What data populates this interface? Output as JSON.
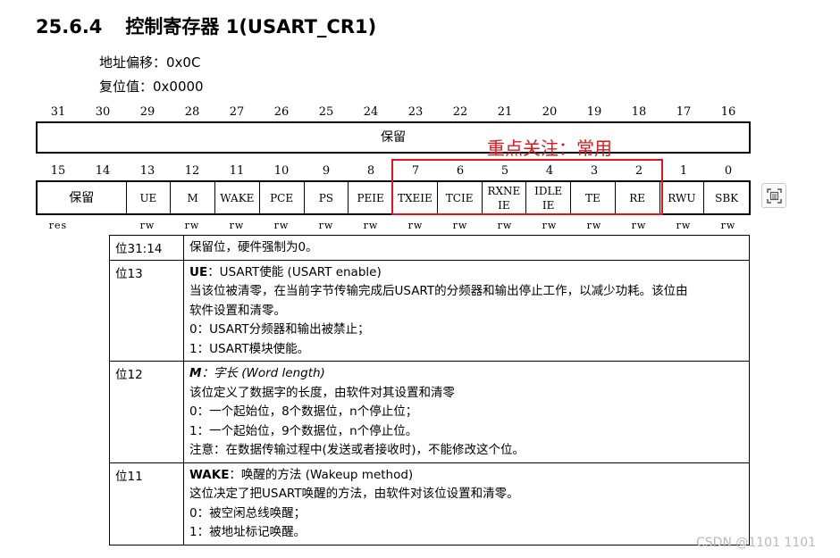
{
  "section": {
    "number": "25.6.4",
    "title": "控制寄存器 1(USART_CR1)"
  },
  "meta": {
    "offset": "地址偏移：0x0C",
    "reset": "复位值：0x0000"
  },
  "register": {
    "high_bit_numbers": [
      "31",
      "30",
      "29",
      "28",
      "27",
      "26",
      "25",
      "24",
      "23",
      "22",
      "21",
      "20",
      "19",
      "18",
      "17",
      "16"
    ],
    "high_reserved_label": "保留",
    "low_bit_numbers": [
      "15",
      "14",
      "13",
      "12",
      "11",
      "10",
      "9",
      "8",
      "7",
      "6",
      "5",
      "4",
      "3",
      "2",
      "1",
      "0"
    ],
    "low_fields": [
      {
        "label": "保留",
        "span": 2
      },
      {
        "label": "UE",
        "span": 1
      },
      {
        "label": "M",
        "span": 1
      },
      {
        "label": "WAKE",
        "span": 1
      },
      {
        "label": "PCE",
        "span": 1
      },
      {
        "label": "PS",
        "span": 1
      },
      {
        "label": "PEIE",
        "span": 1
      },
      {
        "label": "TXEIE",
        "span": 1
      },
      {
        "label": "TCIE",
        "span": 1
      },
      {
        "label": "RXNE\nIE",
        "span": 1
      },
      {
        "label": "IDLE\nIE",
        "span": 1
      },
      {
        "label": "TE",
        "span": 1
      },
      {
        "label": "RE",
        "span": 1
      },
      {
        "label": "RWU",
        "span": 1
      },
      {
        "label": "SBK",
        "span": 1
      }
    ],
    "access": [
      "res",
      "",
      "rw",
      "rw",
      "rw",
      "rw",
      "rw",
      "rw",
      "rw",
      "rw",
      "rw",
      "rw",
      "rw",
      "rw",
      "rw",
      "rw"
    ]
  },
  "annotation": {
    "text": "重点关注：常用",
    "color": "#e0141e"
  },
  "descriptions": [
    {
      "bit": "位31:14",
      "lines": [
        {
          "text": "保留位，硬件强制为0。"
        }
      ]
    },
    {
      "bit": "位13",
      "lines": [
        {
          "name": "UE",
          "rest": "：USART使能 (USART enable)"
        },
        {
          "text": "当该位被清零，在当前字节传输完成后USART的分频器和输出停止工作，以减少功耗。该位由"
        },
        {
          "text": "软件设置和清零。"
        },
        {
          "text": "0：USART分频器和输出被禁止；"
        },
        {
          "text": "1：USART模块使能。"
        }
      ]
    },
    {
      "bit": "位12",
      "lines": [
        {
          "name": "M",
          "rest": "：字长 (Word length)"
        },
        {
          "text": "该位定义了数据字的长度，由软件对其设置和清零"
        },
        {
          "text": "0：一个起始位，8个数据位，n个停止位；"
        },
        {
          "text": "1：一个起始位，9个数据位，n个停止位。"
        },
        {
          "text": "注意：在数据传输过程中(发送或者接收时)，不能修改这个位。"
        }
      ]
    },
    {
      "bit": "位11",
      "lines": [
        {
          "name": "WAKE",
          "rest": "：唤醒的方法 (Wakeup method)"
        },
        {
          "text": "这位决定了把USART唤醒的方法，由软件对该位设置和清零。"
        },
        {
          "text": "0：被空闲总线唤醒；"
        },
        {
          "text": "1：被地址标记唤醒。"
        }
      ]
    }
  ],
  "watermark": "CSDN @1101 1101",
  "icons": {
    "side": "ocr-scan-icon"
  }
}
